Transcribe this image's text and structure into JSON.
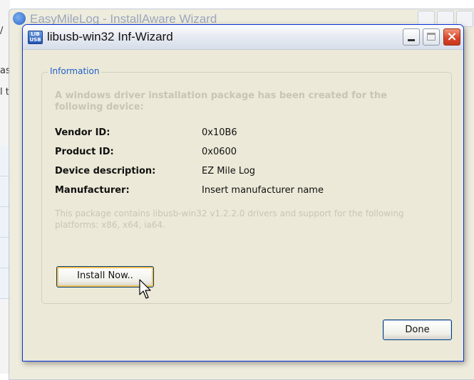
{
  "background": {
    "window_title": "EasyMileLog - InstallAware Wizard",
    "left_fragments": [
      "/",
      "as",
      "l t"
    ]
  },
  "dialog": {
    "title": "libusb-win32 Inf-Wizard",
    "icon_text": "LIB USB",
    "group_label": "Information",
    "description": "A windows driver installation package has been created for the following device:",
    "fields": [
      {
        "label": "Vendor ID:",
        "value": "0x10B6"
      },
      {
        "label": "Product ID:",
        "value": "0x0600"
      },
      {
        "label": "Device description:",
        "value": "EZ Mile Log"
      },
      {
        "label": "Manufacturer:",
        "value": "Insert manufacturer name"
      }
    ],
    "note": "This package contains libusb-win32 v1.2.2.0 drivers and support for the following platforms: x86, x64, ia64.",
    "install_button": "Install Now..",
    "done_button": "Done",
    "controls": {
      "minimize": "minimize-icon",
      "maximize": "maximize-icon",
      "close": "×"
    }
  },
  "colors": {
    "legend": "#1f5fc8",
    "disabled_text": "#c8c5b5",
    "dialog_face": "#ece9d8"
  }
}
